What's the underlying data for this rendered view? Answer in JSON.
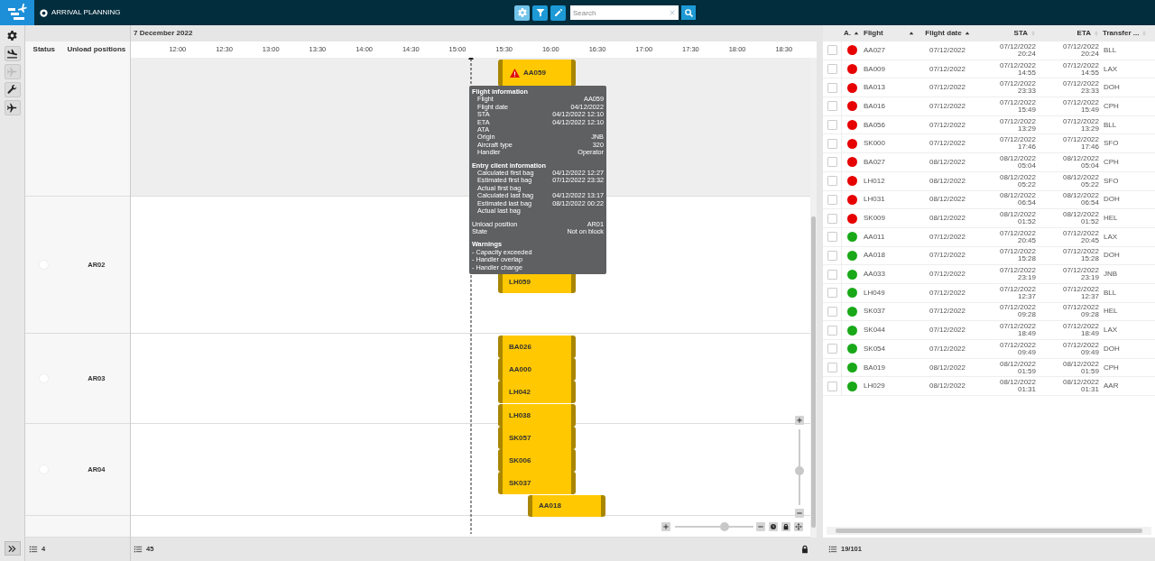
{
  "header": {
    "title": "ARRIVAL PLANNING",
    "toolbar": [
      {
        "kind": "settings",
        "selected": true
      },
      {
        "kind": "filter",
        "selected": false
      },
      {
        "kind": "edit",
        "selected": false
      }
    ],
    "search": {
      "placeholder": "Search"
    }
  },
  "sidebar": {
    "tools": [
      {
        "kind": "settings",
        "disabled": false
      },
      {
        "kind": "landing",
        "disabled": false
      },
      {
        "kind": "plane",
        "disabled": true
      },
      {
        "kind": "wrench",
        "disabled": false
      },
      {
        "kind": "plane",
        "disabled": false
      }
    ]
  },
  "gantt": {
    "date": "7 December 2022",
    "columns": [
      "Status",
      "Unload positions"
    ],
    "times": [
      "12:00",
      "12:30",
      "13:00",
      "13:30",
      "14:00",
      "14:30",
      "15:00",
      "15:30",
      "16:00",
      "16:30",
      "17:00",
      "17:30",
      "18:00",
      "18:30"
    ],
    "rows": [
      {
        "highlighted": true
      },
      {
        "label": "AR02",
        "highlighted": false
      },
      {
        "label": "AR03",
        "highlighted": false
      },
      {
        "label": "AR04",
        "highlighted": false
      },
      {
        "highlighted": false
      }
    ],
    "bars": [
      {
        "flight": "AA059",
        "warning": true
      },
      {
        "flight": "LH059",
        "warning": false
      },
      {
        "flight": "BA026",
        "warning": false
      },
      {
        "flight": "AA000",
        "warning": false
      },
      {
        "flight": "LH042",
        "warning": false
      },
      {
        "flight": "LH038",
        "warning": false
      },
      {
        "flight": "SK057",
        "warning": false
      },
      {
        "flight": "SK006",
        "warning": false
      },
      {
        "flight": "SK037",
        "warning": false
      },
      {
        "flight": "AA018",
        "warning": false
      }
    ],
    "tooltip": {
      "sections": [
        {
          "kind": "indented",
          "title": "Flight information",
          "fields": [
            {
              "label": "Flight",
              "value": "AA059"
            },
            {
              "label": "Flight date",
              "value": "04/12/2022"
            },
            {
              "label": "STA",
              "value": "04/12/2022 12:10"
            },
            {
              "label": "ETA",
              "value": "04/12/2022 12:10"
            },
            {
              "label": "ATA"
            },
            {
              "label": "Origin",
              "value": "JNB"
            },
            {
              "label": "Aircraft type",
              "value": "320"
            },
            {
              "label": "Handler",
              "value": "Operator"
            }
          ]
        },
        {
          "kind": "indented",
          "title": "Entry client information",
          "fields": [
            {
              "label": "Calculated first bag",
              "value": "04/12/2022 12:27"
            },
            {
              "label": "Estimated first bag",
              "value": "07/12/2022 23:32"
            },
            {
              "label": "Actual first bag"
            },
            {
              "label": "Calculated last bag",
              "value": "04/12/2022 13:17"
            },
            {
              "label": "Estimated last bag",
              "value": "08/12/2022 00:22"
            },
            {
              "label": "Actual last bag"
            }
          ]
        },
        {
          "kind": "plain",
          "fields": [
            {
              "label": "Unload position",
              "value": "AR01"
            },
            {
              "label": "State",
              "value": "Not on block"
            }
          ]
        },
        {
          "kind": "list",
          "title": "Warnings",
          "lines": [
            "- Capacity exceeded",
            "- Handler overlap",
            "- Handler change"
          ]
        }
      ]
    },
    "zoom_controls": {
      "vertical": {
        "level": 0.45
      },
      "horizontal": {
        "level": 0.63
      }
    },
    "footer": {
      "rows_count": "4",
      "bars_count": "45"
    }
  },
  "table": {
    "columns": [
      {
        "label": "A.",
        "sorted": true
      },
      {
        "label": "Flight",
        "sorted": true
      },
      {
        "label": "Flight date",
        "sorted": true
      },
      {
        "label": "STA",
        "sorted": false
      },
      {
        "label": "ETA",
        "sorted": false
      },
      {
        "label": "Transfer ...",
        "sorted": false
      }
    ],
    "rows": [
      {
        "checked": false,
        "color": "#e60000",
        "flight": "AA027",
        "date": "07/12/2022",
        "sta": {
          "date": "07/12/2022",
          "time": "20:24"
        },
        "eta": {
          "date": "07/12/2022",
          "time": "20:24"
        },
        "transfer": "BLL"
      },
      {
        "checked": false,
        "color": "#e60000",
        "flight": "BA009",
        "date": "07/12/2022",
        "sta": {
          "date": "07/12/2022",
          "time": "14:55"
        },
        "eta": {
          "date": "07/12/2022",
          "time": "14:55"
        },
        "transfer": "LAX"
      },
      {
        "checked": false,
        "color": "#e60000",
        "flight": "BA013",
        "date": "07/12/2022",
        "sta": {
          "date": "07/12/2022",
          "time": "23:33"
        },
        "eta": {
          "date": "07/12/2022",
          "time": "23:33"
        },
        "transfer": "DOH"
      },
      {
        "checked": false,
        "color": "#e60000",
        "flight": "BA016",
        "date": "07/12/2022",
        "sta": {
          "date": "07/12/2022",
          "time": "15:49"
        },
        "eta": {
          "date": "07/12/2022",
          "time": "15:49"
        },
        "transfer": "CPH"
      },
      {
        "checked": false,
        "color": "#e60000",
        "flight": "BA056",
        "date": "07/12/2022",
        "sta": {
          "date": "07/12/2022",
          "time": "13:29"
        },
        "eta": {
          "date": "07/12/2022",
          "time": "13:29"
        },
        "transfer": "BLL"
      },
      {
        "checked": false,
        "color": "#e60000",
        "flight": "SK000",
        "date": "07/12/2022",
        "sta": {
          "date": "07/12/2022",
          "time": "17:46"
        },
        "eta": {
          "date": "07/12/2022",
          "time": "17:46"
        },
        "transfer": "SFO"
      },
      {
        "checked": false,
        "color": "#e60000",
        "flight": "BA027",
        "date": "08/12/2022",
        "sta": {
          "date": "08/12/2022",
          "time": "05:04"
        },
        "eta": {
          "date": "08/12/2022",
          "time": "05:04"
        },
        "transfer": "CPH"
      },
      {
        "checked": false,
        "color": "#e60000",
        "flight": "LH012",
        "date": "08/12/2022",
        "sta": {
          "date": "08/12/2022",
          "time": "05:22"
        },
        "eta": {
          "date": "08/12/2022",
          "time": "05:22"
        },
        "transfer": "SFO"
      },
      {
        "checked": false,
        "color": "#e60000",
        "flight": "LH031",
        "date": "08/12/2022",
        "sta": {
          "date": "08/12/2022",
          "time": "06:54"
        },
        "eta": {
          "date": "08/12/2022",
          "time": "06:54"
        },
        "transfer": "DOH"
      },
      {
        "checked": false,
        "color": "#e60000",
        "flight": "SK009",
        "date": "08/12/2022",
        "sta": {
          "date": "08/12/2022",
          "time": "01:52"
        },
        "eta": {
          "date": "08/12/2022",
          "time": "01:52"
        },
        "transfer": "HEL"
      },
      {
        "checked": false,
        "color": "#18a818",
        "flight": "AA011",
        "date": "07/12/2022",
        "sta": {
          "date": "07/12/2022",
          "time": "20:45"
        },
        "eta": {
          "date": "07/12/2022",
          "time": "20:45"
        },
        "transfer": "LAX"
      },
      {
        "checked": false,
        "color": "#18a818",
        "flight": "AA018",
        "date": "07/12/2022",
        "sta": {
          "date": "07/12/2022",
          "time": "15:28"
        },
        "eta": {
          "date": "07/12/2022",
          "time": "15:28"
        },
        "transfer": "DOH"
      },
      {
        "checked": false,
        "color": "#18a818",
        "flight": "AA033",
        "date": "07/12/2022",
        "sta": {
          "date": "07/12/2022",
          "time": "23:19"
        },
        "eta": {
          "date": "07/12/2022",
          "time": "23:19"
        },
        "transfer": "JNB"
      },
      {
        "checked": false,
        "color": "#18a818",
        "flight": "LH049",
        "date": "07/12/2022",
        "sta": {
          "date": "07/12/2022",
          "time": "12:37"
        },
        "eta": {
          "date": "07/12/2022",
          "time": "12:37"
        },
        "transfer": "BLL"
      },
      {
        "checked": false,
        "color": "#18a818",
        "flight": "SK037",
        "date": "07/12/2022",
        "sta": {
          "date": "07/12/2022",
          "time": "09:28"
        },
        "eta": {
          "date": "07/12/2022",
          "time": "09:28"
        },
        "transfer": "HEL"
      },
      {
        "checked": false,
        "color": "#18a818",
        "flight": "SK044",
        "date": "07/12/2022",
        "sta": {
          "date": "07/12/2022",
          "time": "18:49"
        },
        "eta": {
          "date": "07/12/2022",
          "time": "18:49"
        },
        "transfer": "LAX"
      },
      {
        "checked": false,
        "color": "#18a818",
        "flight": "SK054",
        "date": "07/12/2022",
        "sta": {
          "date": "07/12/2022",
          "time": "09:49"
        },
        "eta": {
          "date": "07/12/2022",
          "time": "09:49"
        },
        "transfer": "DOH"
      },
      {
        "checked": false,
        "color": "#18a818",
        "flight": "BA019",
        "date": "08/12/2022",
        "sta": {
          "date": "08/12/2022",
          "time": "01:59"
        },
        "eta": {
          "date": "08/12/2022",
          "time": "01:59"
        },
        "transfer": "CPH"
      },
      {
        "checked": false,
        "color": "#18a818",
        "flight": "LH029",
        "date": "08/12/2022",
        "sta": {
          "date": "08/12/2022",
          "time": "01:31"
        },
        "eta": {
          "date": "08/12/2022",
          "time": "01:31"
        },
        "transfer": "AAR"
      }
    ],
    "footer": {
      "count": "19/101"
    }
  }
}
